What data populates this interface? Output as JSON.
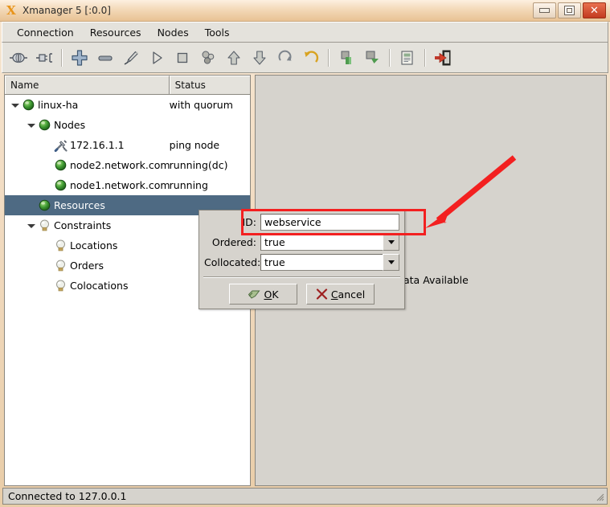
{
  "window": {
    "title": "Xmanager 5 [:0.0]",
    "app_icon": "x-logo-icon",
    "minimize_label": "",
    "maximize_label": "",
    "close_label": "✕"
  },
  "menubar": {
    "items": [
      {
        "label": "Connection"
      },
      {
        "label": "Resources"
      },
      {
        "label": "Nodes"
      },
      {
        "label": "Tools"
      }
    ]
  },
  "toolbar": {
    "items": [
      {
        "name": "connect-icon"
      },
      {
        "name": "disconnect-icon"
      },
      {
        "name": "separator"
      },
      {
        "name": "add-icon"
      },
      {
        "name": "remove-icon"
      },
      {
        "name": "edit-brush-icon"
      },
      {
        "name": "start-icon"
      },
      {
        "name": "stop-icon"
      },
      {
        "name": "migrate-icon"
      },
      {
        "name": "move-up-icon"
      },
      {
        "name": "move-down-icon"
      },
      {
        "name": "refresh-icon"
      },
      {
        "name": "undo-icon"
      },
      {
        "name": "separator"
      },
      {
        "name": "cleanup-icon"
      },
      {
        "name": "paste-icon"
      },
      {
        "name": "separator"
      },
      {
        "name": "report-icon"
      },
      {
        "name": "separator"
      },
      {
        "name": "exit-icon"
      }
    ]
  },
  "tree": {
    "columns": [
      "Name",
      "Status"
    ],
    "rows": [
      {
        "name": "linux-ha",
        "status": "with quorum",
        "indent": 0,
        "twisty": true,
        "icon": "green-ball-icon",
        "selected": false
      },
      {
        "name": "Nodes",
        "status": "",
        "indent": 1,
        "twisty": true,
        "icon": "green-ball-icon",
        "selected": false
      },
      {
        "name": "172.16.1.1",
        "status": "ping node",
        "indent": 2,
        "twisty": false,
        "icon": "tools-icon",
        "selected": false
      },
      {
        "name": "node2.network.com",
        "status": "running(dc)",
        "indent": 2,
        "twisty": false,
        "icon": "green-ball-icon",
        "selected": false
      },
      {
        "name": "node1.network.com",
        "status": "running",
        "indent": 2,
        "twisty": false,
        "icon": "green-ball-icon",
        "selected": false
      },
      {
        "name": "Resources",
        "status": "",
        "indent": 1,
        "twisty": false,
        "icon": "green-ball-icon",
        "selected": true
      },
      {
        "name": "Constraints",
        "status": "",
        "indent": 1,
        "twisty": true,
        "icon": "bulb-icon",
        "selected": false
      },
      {
        "name": "Locations",
        "status": "",
        "indent": 2,
        "twisty": false,
        "icon": "bulb-icon",
        "selected": false
      },
      {
        "name": "Orders",
        "status": "",
        "indent": 2,
        "twisty": false,
        "icon": "bulb-icon",
        "selected": false
      },
      {
        "name": "Colocations",
        "status": "",
        "indent": 2,
        "twisty": false,
        "icon": "bulb-icon",
        "selected": false
      }
    ]
  },
  "right_panel": {
    "message": "ata Available"
  },
  "dialog": {
    "id_label": "ID:",
    "id_value": "webservice",
    "id_placeholder": "",
    "ordered_label": "Ordered:",
    "ordered_value": "true",
    "collocated_label": "Collocated:",
    "collocated_value": "true",
    "combo_options": [
      "true",
      "false"
    ],
    "ok_label": "OK",
    "ok_mnemonic": "O",
    "ok_rest": "K",
    "cancel_label": "Cancel",
    "cancel_mnemonic": "C",
    "cancel_rest": "ancel"
  },
  "annotation": {
    "highlight_color": "#f32020",
    "arrow_color": "#f32020",
    "target": "id-field"
  },
  "statusbar": {
    "text": "Connected to 127.0.0.1"
  },
  "colors": {
    "selection": "#4e6a83",
    "panel_bg": "#d6d3cd",
    "titlebar": "#f0d7b5"
  }
}
